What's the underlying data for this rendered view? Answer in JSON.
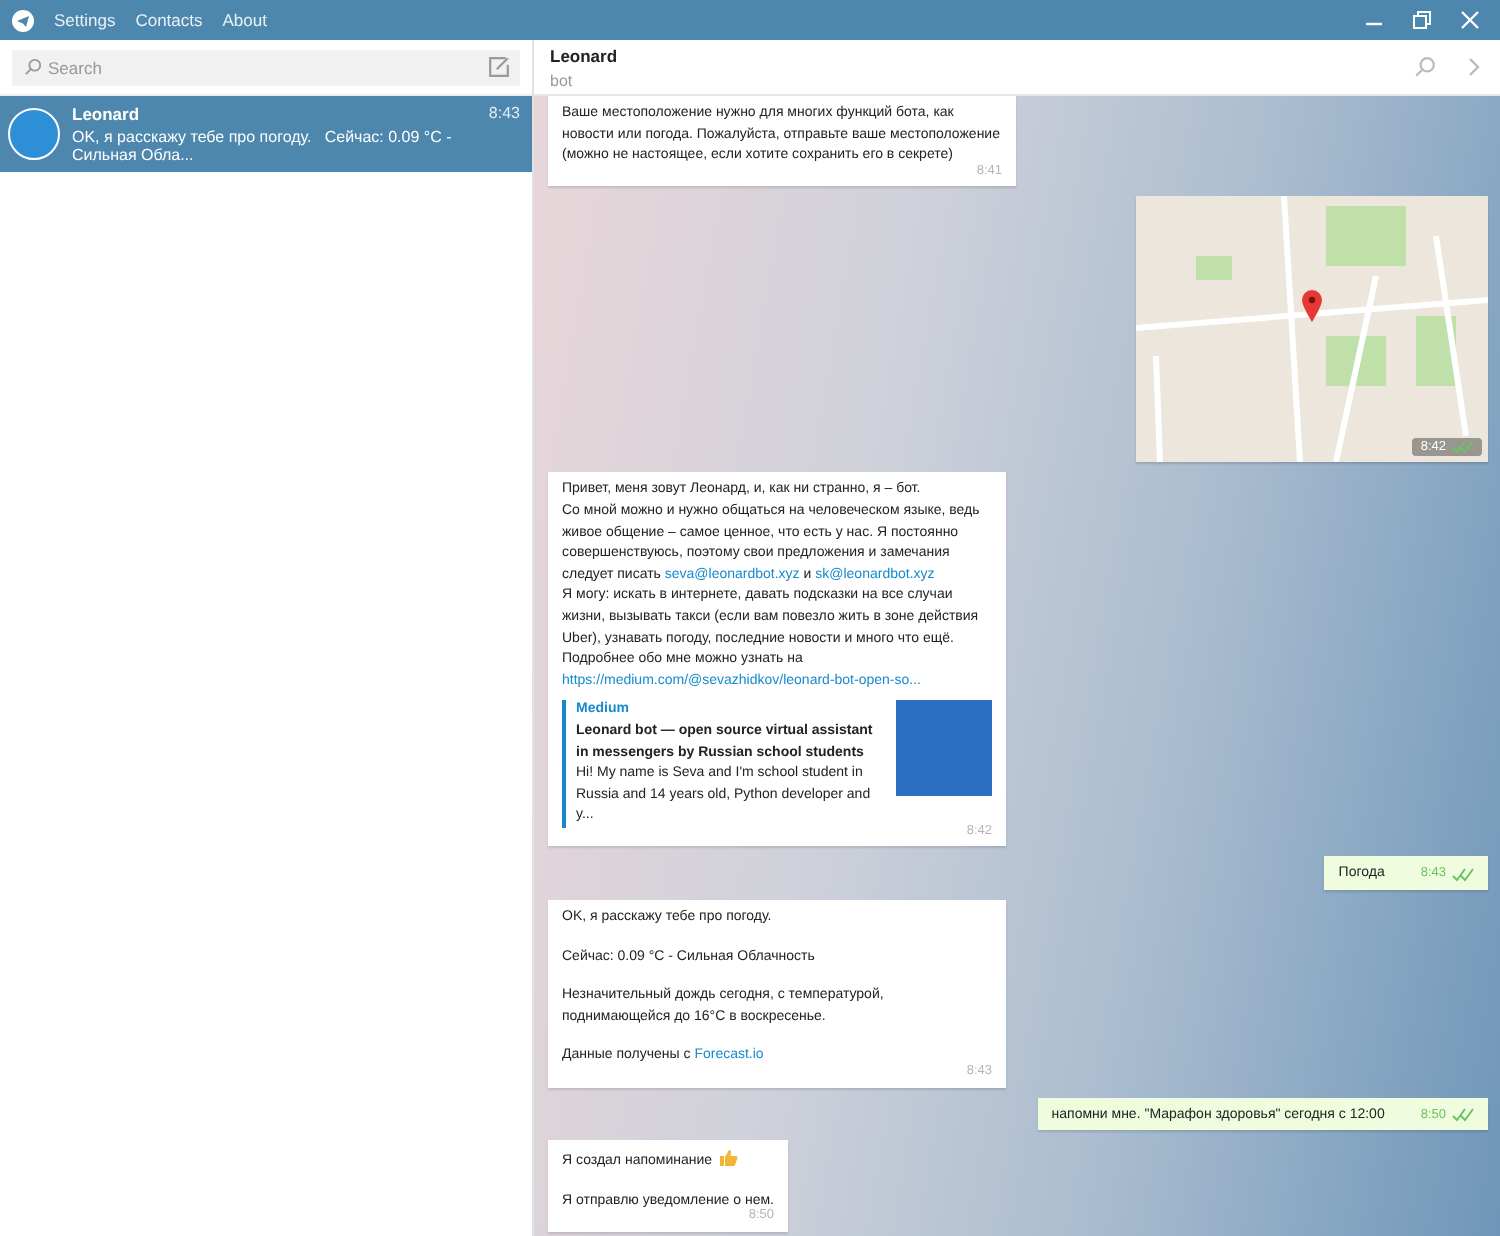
{
  "menu": [
    "Settings",
    "Contacts",
    "About"
  ],
  "search": {
    "placeholder": "Search"
  },
  "chats": [
    {
      "name": "Leonard",
      "time": "8:43",
      "preview": "OK, я расскажу тебе про погоду.   Сейчас: 0.09 °C - Сильная Обла...",
      "selected": true
    }
  ],
  "header": {
    "name": "Leonard",
    "status": "bot"
  },
  "messages": [
    {
      "kind": "text",
      "outgoing": false,
      "time": "8:41",
      "paragraphs": [
        [
          {
            "text": "Ваше местоположение нужно для многих функций бота, как новости или погода. Пожалуйста, отправьте ваше местоположение (можно не настоящее, если хотите сохранить его в секрете)"
          }
        ]
      ]
    },
    {
      "kind": "map",
      "outgoing": true,
      "time": "8:42",
      "read": true
    },
    {
      "kind": "text",
      "outgoing": false,
      "spaced": false,
      "time": "8:42",
      "paragraphs": [
        [
          {
            "text": "Привет, меня зовут Леонард, и, как ни странно, я – бот."
          }
        ],
        [
          {
            "text": "Со мной можно и нужно общаться на человеческом языке, ведь живое общение – самое ценное, что есть у нас. Я постоянно совершенствуюсь, поэтому свои предложения и замечания следует писать "
          },
          {
            "text": "seva@leonardbot.xyz",
            "link": true
          },
          {
            "text": " и "
          },
          {
            "text": "sk@leonardbot.xyz",
            "link": true
          }
        ],
        [
          {
            "text": "Я могу: искать в интернете, давать подсказки на все случаи жизни, вызывать такси (если вам повезло жить в зоне действия Uber), узнавать погоду, последние новости и много что ещё. Подробнее обо мне можно узнать на "
          },
          {
            "text": "https://medium.com/@sevazhidkov/leonard-bot-open-so...",
            "link": true
          }
        ]
      ],
      "preview": {
        "site": "Medium",
        "title": "Leonard bot — open source virtual assistant in messengers by Russian school students",
        "description": "Hi! My name is Seva and I'm school student in Russia and 14 years old, Python developer and y..."
      }
    },
    {
      "kind": "text",
      "outgoing": true,
      "time": "8:43",
      "read": true,
      "paragraphs": [
        [
          {
            "text": "Погода"
          }
        ]
      ]
    },
    {
      "kind": "text",
      "outgoing": false,
      "spaced": true,
      "time": "8:43",
      "paragraphs": [
        [
          {
            "text": "OK, я расскажу тебе про погоду."
          }
        ],
        [
          {
            "text": "Сейчас: 0.09 °C - Сильная Облачность"
          }
        ],
        [
          {
            "text": "Незначительный дождь сегодня, с температурой, поднимающейся до 16°C в воскресенье."
          }
        ],
        [
          {
            "text": "Данные получены с "
          },
          {
            "text": "Forecast.io",
            "link": true
          }
        ]
      ]
    },
    {
      "kind": "text",
      "outgoing": true,
      "time": "8:50",
      "read": true,
      "paragraphs": [
        [
          {
            "text": "напомни мне. \"Марафон здоровья\" сегодня с 12:00"
          }
        ]
      ]
    },
    {
      "kind": "text",
      "outgoing": false,
      "spaced": true,
      "time": "8:50",
      "thumbs": true,
      "paragraphs": [
        [
          {
            "text": "Я создал напоминание"
          }
        ],
        [
          {
            "text": "Я отправлю уведомление о нем."
          }
        ]
      ]
    }
  ]
}
